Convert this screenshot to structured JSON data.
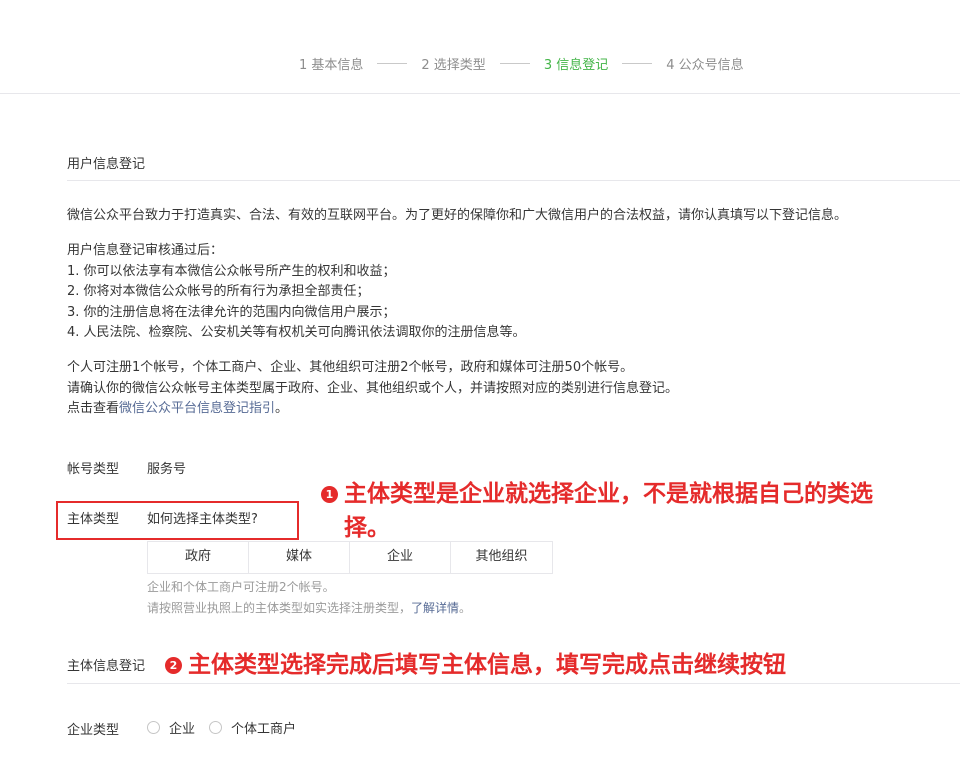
{
  "steps": [
    {
      "label": "1 基本信息"
    },
    {
      "label": "2 选择类型"
    },
    {
      "label": "3 信息登记"
    },
    {
      "label": "4 公众号信息"
    }
  ],
  "user_info": {
    "title": "用户信息登记",
    "intro": "微信公众平台致力于打造真实、合法、有效的互联网平台。为了更好的保障你和广大微信用户的合法权益，请你认真填写以下登记信息。",
    "after_title": "用户信息登记审核通过后：",
    "rules": [
      "1. 你可以依法享有本微信公众帐号所产生的权利和收益；",
      "2. 你将对本微信公众帐号的所有行为承担全部责任；",
      "3. 你的注册信息将在法律允许的范围内向微信用户展示；",
      "4. 人民法院、检察院、公安机关等有权机关可向腾讯依法调取你的注册信息等。"
    ],
    "notes": [
      "个人可注册1个帐号，个体工商户、企业、其他组织可注册2个帐号，政府和媒体可注册50个帐号。",
      "请确认你的微信公众帐号主体类型属于政府、企业、其他组织或个人，并请按照对应的类别进行信息登记。"
    ],
    "guide_prefix": "点击查看",
    "guide_link": "微信公众平台信息登记指引",
    "guide_suffix": "。"
  },
  "account_type": {
    "label": "帐号类型",
    "value": "服务号"
  },
  "subject_type": {
    "label": "主体类型",
    "help_link": "如何选择主体类型?",
    "options": [
      {
        "label": "政府"
      },
      {
        "label": "媒体"
      },
      {
        "label": "企业"
      },
      {
        "label": "其他组织"
      }
    ],
    "tip1": "企业和个体工商户可注册2个帐号。",
    "tip2_prefix": "请按照营业执照上的主体类型如实选择注册类型，",
    "tip2_link": "了解详情",
    "tip2_suffix": "。"
  },
  "subject_info": {
    "title": "主体信息登记"
  },
  "enterprise_type": {
    "label": "企业类型",
    "options": [
      {
        "label": "企业"
      },
      {
        "label": "个体工商户"
      }
    ]
  },
  "annotations": {
    "a1_num": "1",
    "a1_line1": "主体类型是企业就选择企业，不是就根据自己的类选",
    "a1_line2": "择。",
    "a2_num": "2",
    "a2_text": "主体类型选择完成后填写主体信息，填写完成点击继续按钮"
  },
  "colors": {
    "accent_green": "#44b549",
    "link_blue": "#576b95",
    "annotation_red": "#e52b2b"
  }
}
